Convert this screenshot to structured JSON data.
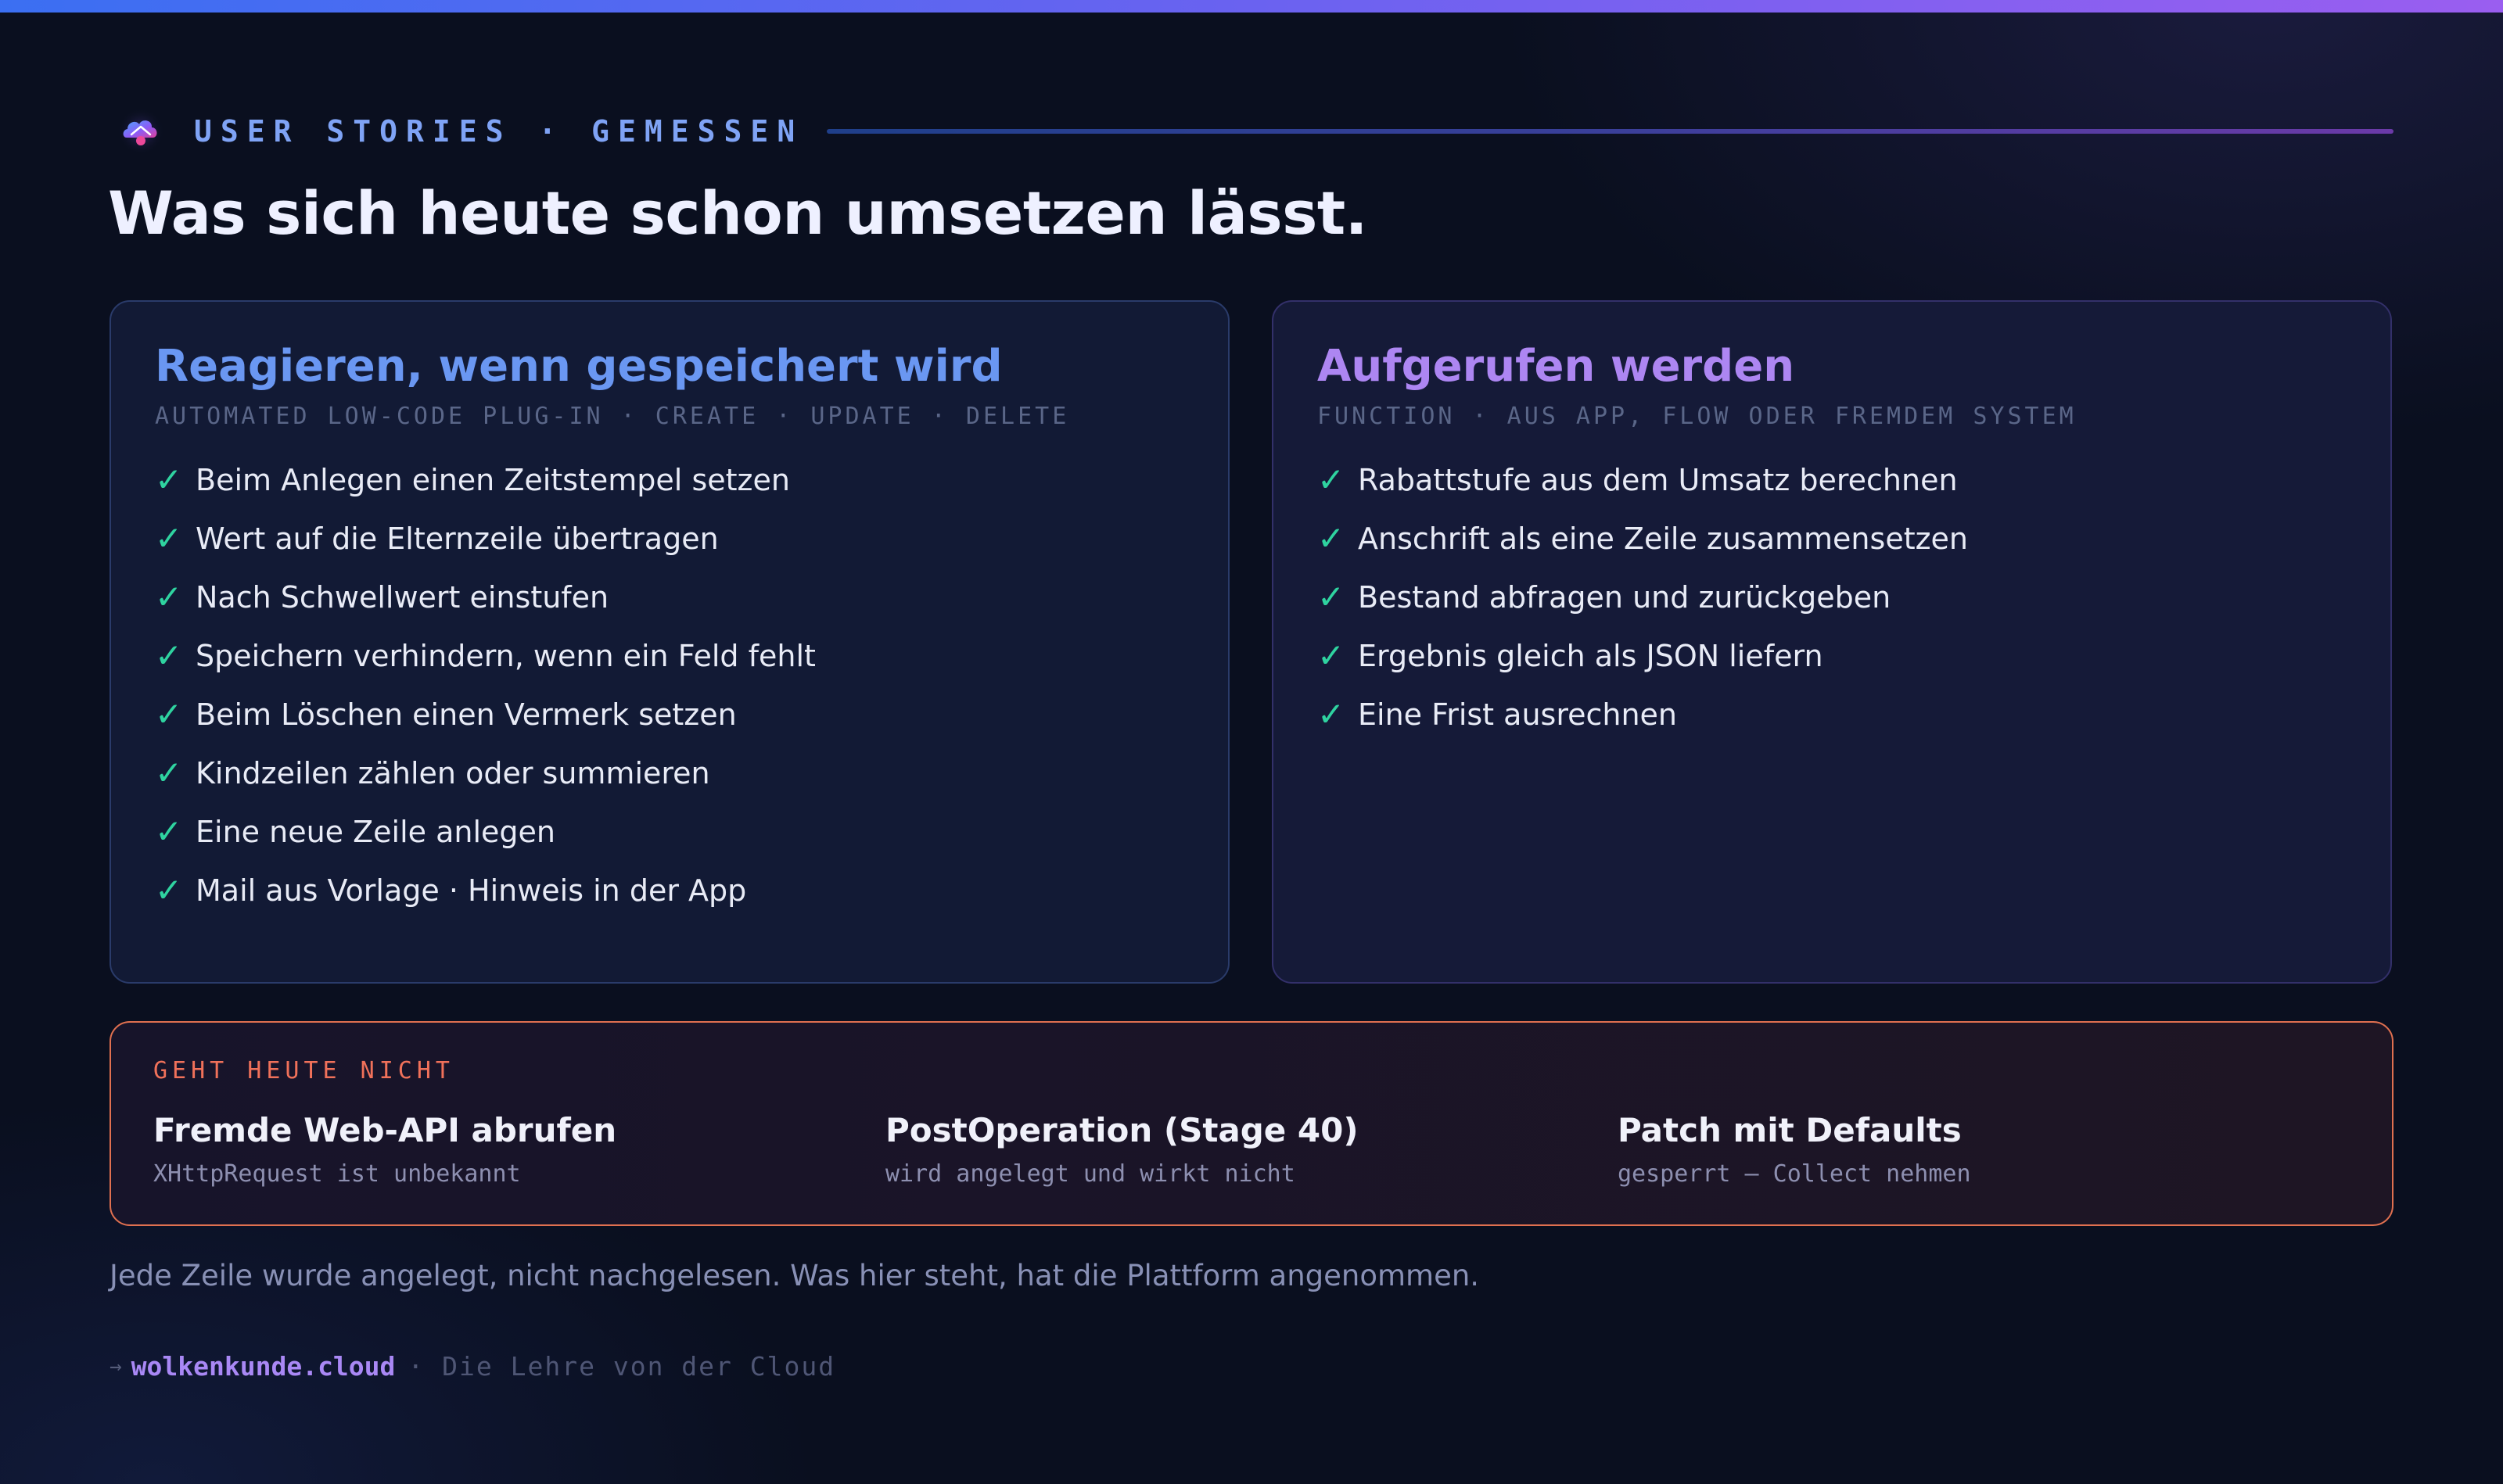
{
  "eyebrow": {
    "label": "USER STORIES · GEMESSEN"
  },
  "headline": "Was sich heute schon umsetzen lässt.",
  "cards": [
    {
      "title": "Reagieren, wenn gespeichert wird",
      "subtitle": "AUTOMATED LOW-CODE PLUG-IN · CREATE · UPDATE · DELETE",
      "items": [
        "Beim Anlegen einen Zeitstempel setzen",
        "Wert auf die Elternzeile übertragen",
        "Nach Schwellwert einstufen",
        "Speichern verhindern, wenn ein Feld fehlt",
        "Beim Löschen einen Vermerk setzen",
        "Kindzeilen zählen oder summieren",
        "Eine neue Zeile anlegen",
        "Mail aus Vorlage · Hinweis in der App"
      ]
    },
    {
      "title": "Aufgerufen werden",
      "subtitle": "FUNCTION · AUS APP, FLOW ODER FREMDEM SYSTEM",
      "items": [
        "Rabattstufe aus dem Umsatz berechnen",
        "Anschrift als eine Zeile zusammensetzen",
        "Bestand abfragen und zurückgeben",
        "Ergebnis gleich als JSON liefern",
        "Eine Frist ausrechnen"
      ]
    }
  ],
  "check_glyph": "✓",
  "not_today": {
    "label": "GEHT HEUTE NICHT",
    "items": [
      {
        "title": "Fremde Web-API abrufen",
        "desc": "XHttpRequest ist unbekannt"
      },
      {
        "title": "PostOperation (Stage 40)",
        "desc": "wird angelegt und wirkt nicht"
      },
      {
        "title": "Patch mit Defaults",
        "desc": "gesperrt — Collect nehmen"
      }
    ]
  },
  "footnote": "Jede Zeile wurde angelegt, nicht nachgelesen. Was hier steht, hat die Plattform angenommen.",
  "footer": {
    "arrow": "→",
    "domain": "wolkenkunde.cloud",
    "tagline": "· Die Lehre von der Cloud"
  },
  "colors": {
    "background": "#0a0f1f",
    "accent_blue": "#6a97f2",
    "accent_purple": "#ad86f2",
    "check_green": "#2fd3a0",
    "warning_orange": "#f0715a"
  },
  "icons": {
    "logo": "cloud-logo-icon",
    "check": "check-icon"
  }
}
